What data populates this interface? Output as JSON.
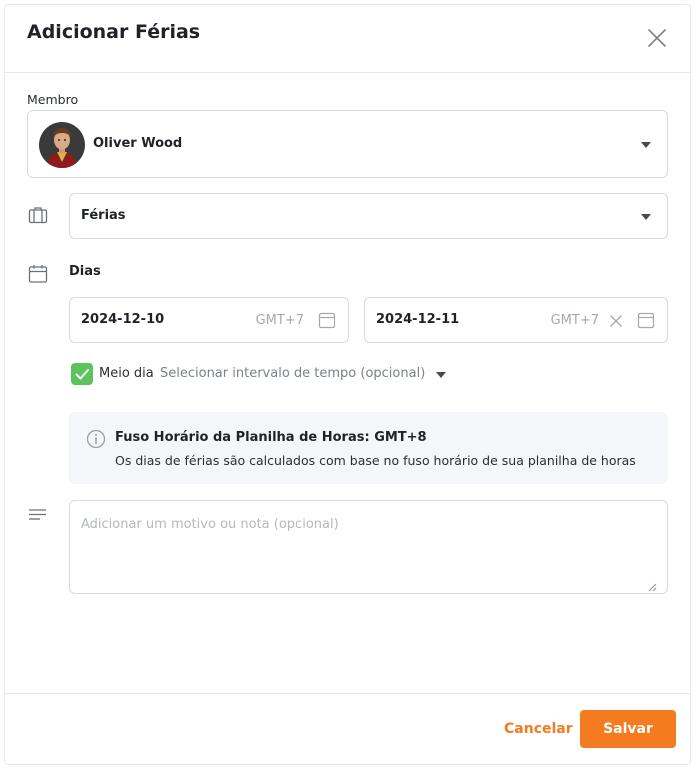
{
  "dialog": {
    "title": "Adicionar Férias",
    "close_icon": "close-icon"
  },
  "member": {
    "label": "Membro",
    "selected": "Oliver Wood",
    "avatar_icon": "user-avatar"
  },
  "leave_type": {
    "icon": "briefcase-icon",
    "selected": "Férias"
  },
  "days": {
    "icon": "calendar-icon",
    "label": "Dias",
    "start_date": "2024-12-10",
    "start_tz": "GMT+7",
    "end_date": "2024-12-11",
    "end_tz": "GMT+7"
  },
  "half_day": {
    "checked": true,
    "label": "Meio dia",
    "interval_placeholder": "Selecionar intervalo de tempo (opcional)"
  },
  "timezone_info": {
    "icon": "info-icon",
    "title": "Fuso Horário da Planilha de Horas: GMT+8",
    "description": "Os dias de férias são calculados com base no fuso horário de sua planilha de horas"
  },
  "note": {
    "icon": "notes-lines-icon",
    "placeholder": "Adicionar um motivo ou nota (opcional)",
    "value": ""
  },
  "footer": {
    "cancel_label": "Cancelar",
    "save_label": "Salvar"
  },
  "colors": {
    "accent": "#f47b20",
    "checkbox": "#5cc35d",
    "info_bg": "#f4f6f9",
    "border": "#d7dade"
  }
}
